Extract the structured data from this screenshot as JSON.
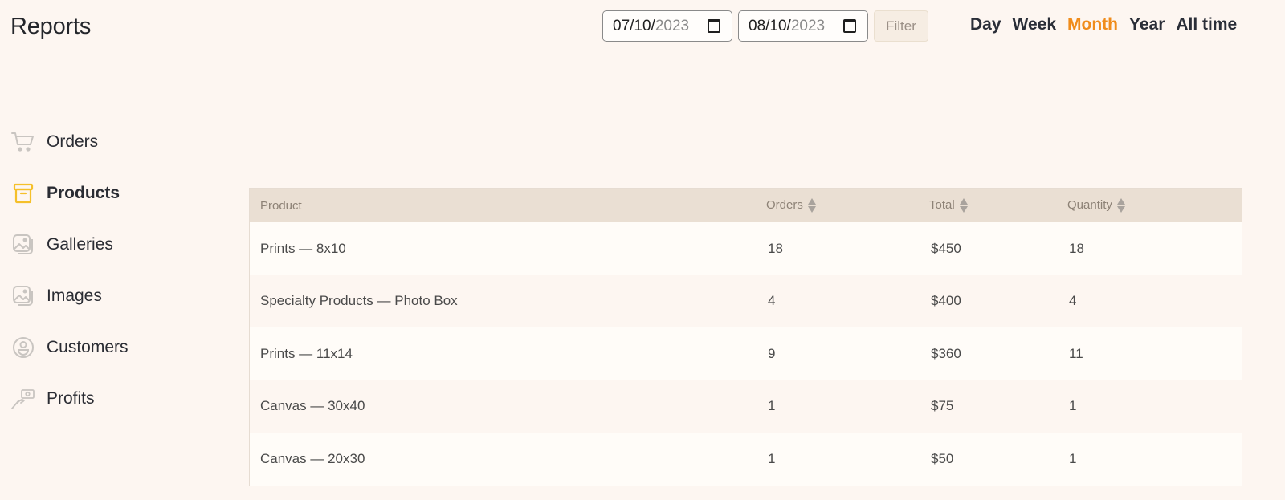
{
  "header": {
    "title": "Reports",
    "date_from": {
      "month_day": "07/10/",
      "year": "2023",
      "icon": "calendar-icon"
    },
    "date_to": {
      "month_day": "08/10/",
      "year": "2023",
      "icon": "calendar-icon"
    },
    "filter_label": "Filter",
    "periods": [
      {
        "label": "Day",
        "active": false
      },
      {
        "label": "Week",
        "active": false
      },
      {
        "label": "Month",
        "active": true
      },
      {
        "label": "Year",
        "active": false
      },
      {
        "label": "All time",
        "active": false
      }
    ],
    "accent_color": "#f08c1b"
  },
  "sidebar": {
    "items": [
      {
        "label": "Orders",
        "icon": "cart-icon",
        "active": false
      },
      {
        "label": "Products",
        "icon": "box-icon",
        "active": true
      },
      {
        "label": "Galleries",
        "icon": "gallery-icon",
        "active": false
      },
      {
        "label": "Images",
        "icon": "image-icon",
        "active": false
      },
      {
        "label": "Customers",
        "icon": "user-circle-icon",
        "active": false
      },
      {
        "label": "Profits",
        "icon": "hand-money-icon",
        "active": false
      }
    ],
    "active_icon_color": "#f5c02a",
    "inactive_icon_color": "#c9c5c1"
  },
  "table": {
    "columns": [
      {
        "label": "Product",
        "sortable": false
      },
      {
        "label": "Orders",
        "sortable": true
      },
      {
        "label": "Total",
        "sortable": true
      },
      {
        "label": "Quantity",
        "sortable": true
      }
    ],
    "rows": [
      {
        "product": "Prints — 8x10",
        "orders": "18",
        "total": "$450",
        "quantity": "18"
      },
      {
        "product": "Specialty Products — Photo Box",
        "orders": "4",
        "total": "$400",
        "quantity": "4"
      },
      {
        "product": "Prints — 11x14",
        "orders": "9",
        "total": "$360",
        "quantity": "11"
      },
      {
        "product": "Canvas — 30x40",
        "orders": "1",
        "total": "$75",
        "quantity": "1"
      },
      {
        "product": "Canvas — 20x30",
        "orders": "1",
        "total": "$50",
        "quantity": "1"
      }
    ]
  }
}
